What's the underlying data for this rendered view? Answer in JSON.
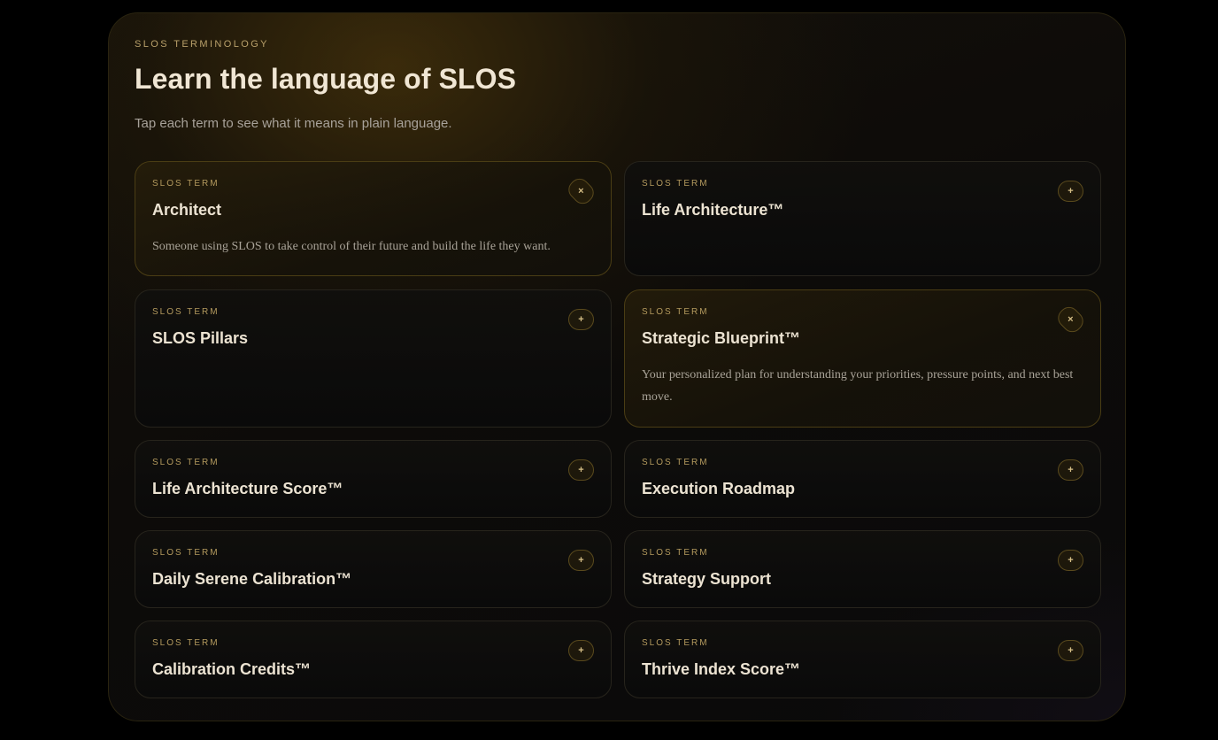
{
  "section": {
    "eyebrow": "SLOS TERMINOLOGY",
    "title": "Learn the language of SLOS",
    "subtitle": "Tap each term to see what it means in plain language."
  },
  "terms": [
    {
      "label": "SLOS TERM",
      "name": "Architect",
      "expanded": true,
      "toggle": "×",
      "definition": "Someone using SLOS to take control of their future and build the life they want."
    },
    {
      "label": "SLOS TERM",
      "name": "Life Architecture™",
      "expanded": false,
      "toggle": "+",
      "definition": ""
    },
    {
      "label": "SLOS TERM",
      "name": "SLOS Pillars",
      "expanded": false,
      "toggle": "+",
      "definition": ""
    },
    {
      "label": "SLOS TERM",
      "name": "Strategic Blueprint™",
      "expanded": true,
      "toggle": "×",
      "definition": "Your personalized plan for understanding your priorities, pressure points, and next best move."
    },
    {
      "label": "SLOS TERM",
      "name": "Life Architecture Score™",
      "expanded": false,
      "toggle": "+",
      "definition": ""
    },
    {
      "label": "SLOS TERM",
      "name": "Execution Roadmap",
      "expanded": false,
      "toggle": "+",
      "definition": ""
    },
    {
      "label": "SLOS TERM",
      "name": "Daily Serene Calibration™",
      "expanded": false,
      "toggle": "+",
      "definition": ""
    },
    {
      "label": "SLOS TERM",
      "name": "Strategy Support",
      "expanded": false,
      "toggle": "+",
      "definition": ""
    },
    {
      "label": "SLOS TERM",
      "name": "Calibration Credits™",
      "expanded": false,
      "toggle": "+",
      "definition": ""
    },
    {
      "label": "SLOS TERM",
      "name": "Thrive Index Score™",
      "expanded": false,
      "toggle": "+",
      "definition": ""
    }
  ],
  "colors": {
    "accent": "#b9a06a",
    "heading": "#f0e6d4",
    "background": "#000000"
  }
}
